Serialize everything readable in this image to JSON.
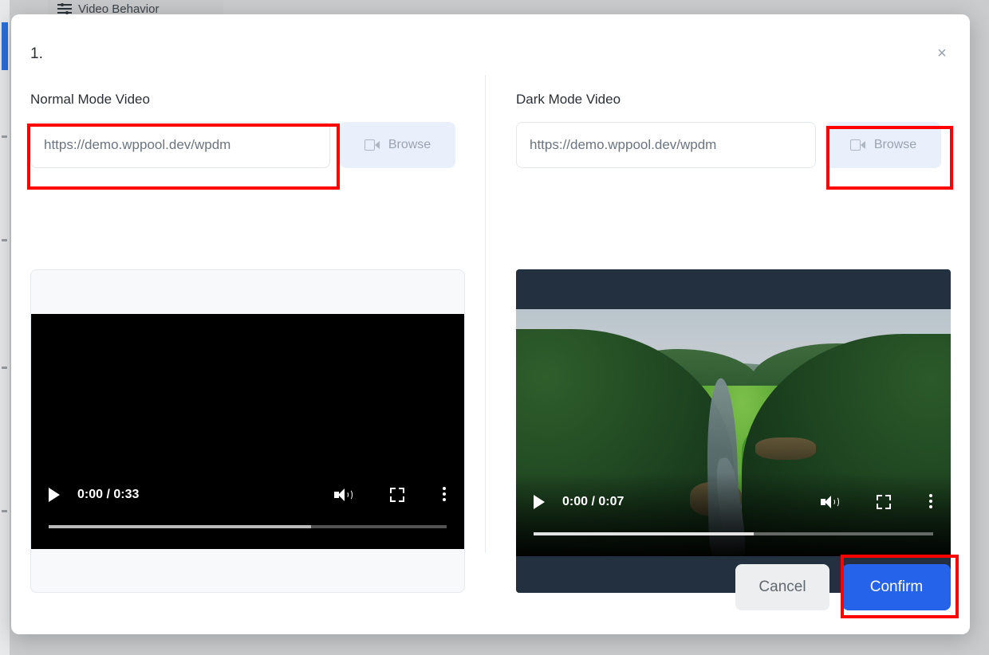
{
  "background": {
    "menu_item_label": "Video Behavior",
    "menu_icon": "sliders-icon",
    "accent_color": "#2a6fdb",
    "backdrop_color": "#c9cbcd"
  },
  "modal": {
    "title": "1.",
    "close_label": "×",
    "close_icon": "close-icon",
    "columns": [
      {
        "id": "normal",
        "label": "Normal Mode Video",
        "input": {
          "value": "https://demo.wppool.dev/wpdm",
          "placeholder": "https://demo.wppool.dev/wpdm",
          "full_value": "https://demo.wppool.dev/wpdm"
        },
        "browse": {
          "label": "Browse",
          "icon": "video-camera-icon",
          "background": "#e9f0fb",
          "text_color": "#9aa4b0"
        },
        "preview": {
          "mode": "light-frame-black-video",
          "frame_background": "#f7f9fb",
          "video_background": "#000000",
          "controls": {
            "play_icon": "play-icon",
            "time": "0:00 / 0:33",
            "current_time": "0:00",
            "duration": "0:33",
            "volume_icon": "volume-high-icon",
            "fullscreen_icon": "fullscreen-icon",
            "more_icon": "more-vertical-icon",
            "progress_percent": 66
          }
        }
      },
      {
        "id": "dark",
        "label": "Dark Mode Video",
        "input": {
          "value": "https://demo.wppool.dev/wpdm",
          "placeholder": "https://demo.wppool.dev/wpdm",
          "full_value": "https://demo.wppool.dev/wpdm"
        },
        "browse": {
          "label": "Browse",
          "icon": "video-camera-icon",
          "background": "#e9f0fb",
          "text_color": "#9aa4b0"
        },
        "preview": {
          "mode": "dark-frame-landscape-video",
          "frame_background": "#22303f",
          "scene_description": "aerial view of green forested valley with river",
          "controls": {
            "play_icon": "play-icon",
            "time": "0:00 / 0:07",
            "current_time": "0:00",
            "duration": "0:07",
            "volume_icon": "volume-high-icon",
            "fullscreen_icon": "fullscreen-icon",
            "more_icon": "more-vertical-icon",
            "progress_percent": 55
          }
        }
      }
    ],
    "footer": {
      "cancel_label": "Cancel",
      "confirm_label": "Confirm",
      "confirm_color": "#2563eb",
      "cancel_color": "#eceef0"
    }
  },
  "annotations": {
    "highlight_color": "#ff0000",
    "boxes": [
      {
        "target": "normal-mode-url-input"
      },
      {
        "target": "dark-mode-browse-button"
      },
      {
        "target": "confirm-button"
      }
    ]
  }
}
